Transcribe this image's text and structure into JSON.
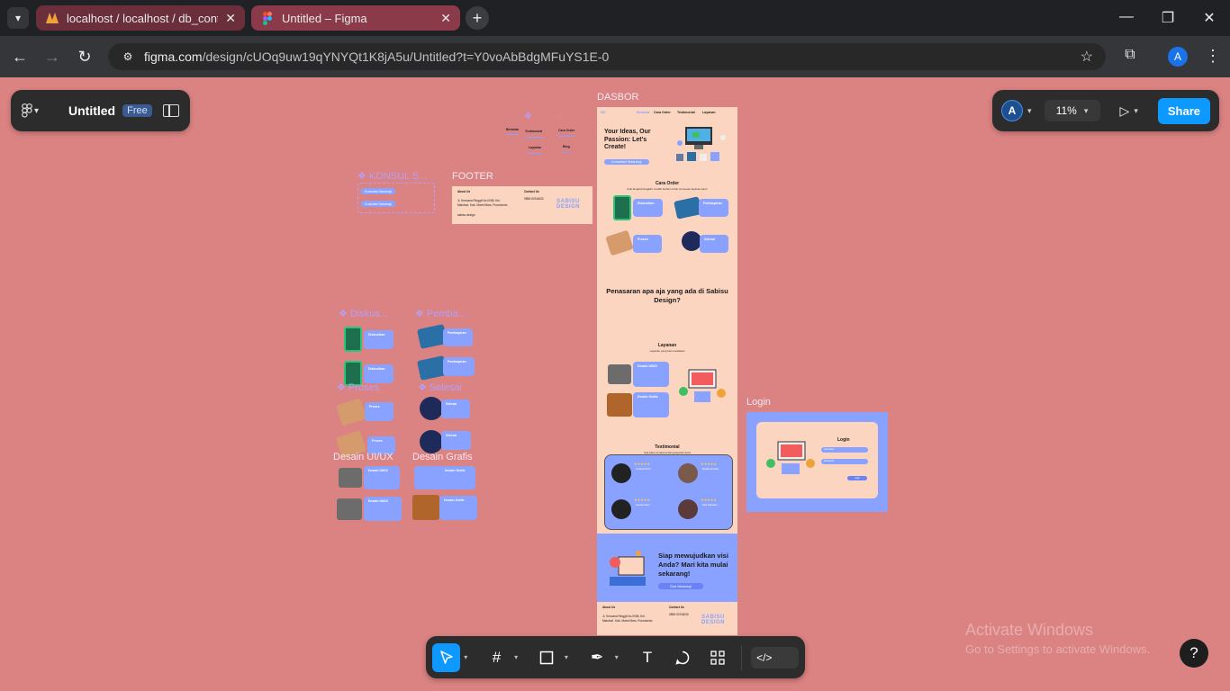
{
  "browser": {
    "tabs": [
      {
        "title": "localhost / localhost / db_conta",
        "active": false
      },
      {
        "title": "Untitled – Figma",
        "active": true
      }
    ],
    "new_tab": "+",
    "url_host": "figma.com",
    "url_path": "/design/cUOq9uw19qYNYQt1K8jA5u/Untitled?t=Y0voAbBdgMFuYS1E-0",
    "profile_initial": "A"
  },
  "figma": {
    "file_name": "Untitled",
    "plan": "Free",
    "user_initial": "A",
    "zoom": "11%",
    "share_label": "Share",
    "help": "?"
  },
  "canvas": {
    "frames": {
      "dasbor": "DASBOR",
      "footer": "FOOTER",
      "login": "Login"
    },
    "components": {
      "konsul": "❖ KONSUL S...",
      "diskusi": "❖ Diskus...",
      "pembayaran": "❖ Pemba...",
      "proses": "❖ Proses",
      "selesai": "❖ Selesai",
      "desain_uiux": "Desain UI/UX",
      "desain_grafis": "Desain Grafis"
    },
    "konsul_buttons": [
      "Konsultasi Sekarang!",
      "Konsultasi Sekarang!"
    ],
    "nav_components": [
      "Beranda",
      "Testimonial",
      "Cara Order",
      "Layanan",
      "Blog"
    ],
    "dasbor": {
      "nav": [
        "Beranda",
        "Cara Order",
        "Testimonial",
        "Layanan"
      ],
      "hero_title": "Your Ideas, Our Passion: Let's Create!",
      "hero_button": "Konsultasi Sekarang!",
      "cara_order_title": "Cara Order",
      "cara_order_sub": "Ikuti langkah-langkah mudah berikut untuk memesan layanan kami",
      "steps": [
        "Diskusikan",
        "Pembayaran",
        "Proses",
        "Selesai"
      ],
      "penasaran": "Penasaran apa aja yang ada di Sabisu Design?",
      "layanan_title": "Layanan",
      "layanan_sub": "Layanan yang kami sediakan",
      "layanan_items": [
        "Desain UI/UX",
        "Desain Grafis"
      ],
      "testimonial_title": "Testimonial",
      "testimonial_sub": "Apa kata mereka tentang layanan kami",
      "testimonials": [
        "Andrea Putri",
        "Nadia Amalia",
        "Aurelia Sari",
        "Sari Maulani"
      ],
      "stars": "★★★★★",
      "cta": "Siap mewujudkan visi Anda? Mari kita mulai sekarang!",
      "cta_button": "Chat Sekarang!"
    },
    "footer": {
      "about_title": "About Us",
      "address": "Jl. Kencana Ringgit No.0008, Kel. Maluhuri, Kab. Maret Mars, Purwokerto.",
      "instagram": "sabisu.design",
      "contact_title": "Contact Us",
      "phone": "0855-929-8630",
      "brand": "SABISU DESIGN"
    },
    "login": {
      "title": "Login",
      "username_placeholder": "Username",
      "password_placeholder": "Password",
      "button": "Login"
    }
  },
  "watermark": {
    "line1": "Activate Windows",
    "line2": "Go to Settings to activate Windows."
  },
  "colors": {
    "canvas": "#db8282",
    "frame_blue": "#8aa2ff",
    "peach": "#fcd5c0",
    "figma_blue": "#0d99ff"
  }
}
